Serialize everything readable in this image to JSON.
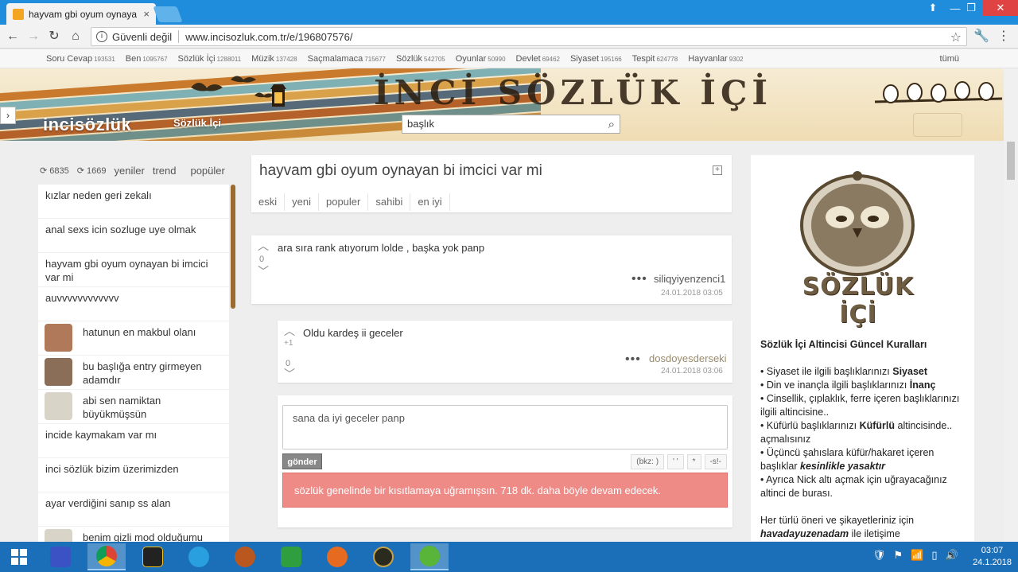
{
  "browser": {
    "tab_title": "hayvam gbi oyum oynaya",
    "tab_close": "×",
    "security_label": "Güvenli değil",
    "url": "www.incisozluk.com.tr/e/196807576/",
    "icons": [
      "back-icon",
      "forward-icon",
      "reload-icon",
      "home-icon",
      "info-icon",
      "star-icon",
      "extension-icon",
      "menu-icon"
    ]
  },
  "categories": [
    {
      "name": "Soru Cevap",
      "count": "193531"
    },
    {
      "name": "Ben",
      "count": "1095767"
    },
    {
      "name": "Sözlük İçi",
      "count": "1288011"
    },
    {
      "name": "Müzik",
      "count": "137428"
    },
    {
      "name": "Saçmalamaca",
      "count": "715677"
    },
    {
      "name": "Sözlük",
      "count": "542705"
    },
    {
      "name": "Oyunlar",
      "count": "50990"
    },
    {
      "name": "Devlet",
      "count": "69462"
    },
    {
      "name": "Siyaset",
      "count": "195166"
    },
    {
      "name": "Tespit",
      "count": "624778"
    },
    {
      "name": "Hayvanlar",
      "count": "9302"
    }
  ],
  "categories_all": "tümü",
  "banner": {
    "logo": "incisözlük",
    "section_label": "Sözlük İçi",
    "title": "İNCİ SÖZLÜK İÇİ",
    "search_placeholder": "başlık"
  },
  "left": {
    "count_a": "6835",
    "count_b": "1669",
    "tabs": [
      "yeniler",
      "trend",
      "popüler"
    ],
    "items": [
      {
        "text": "kızlar neden geri zekalı",
        "avatar": false
      },
      {
        "text": "anal sexs icin sozluge uye olmak",
        "avatar": false
      },
      {
        "text": "hayvam gbi oyum oynayan bi imcici var mi",
        "avatar": false
      },
      {
        "text": "auvvvvvvvvvvvv",
        "avatar": false
      },
      {
        "text": "hatunun en makbul olanı",
        "avatar": true
      },
      {
        "text": "bu başlığa entry girmeyen adamdır",
        "avatar": true
      },
      {
        "text": "abi sen namiktan büyükmüşsün",
        "avatar": true
      },
      {
        "text": "incide kaymakam var mı",
        "avatar": false
      },
      {
        "text": "inci sözlük bizim üzerimizden",
        "avatar": false
      },
      {
        "text": "ayar verdiğini sanıp ss alan",
        "avatar": false
      },
      {
        "text": "benim gizli mod olduğumu",
        "avatar": true
      }
    ]
  },
  "topic": {
    "title": "hayvam gbi oyum oynayan bi imcici var mi",
    "expand": "+",
    "tabs": [
      "eski",
      "yeni",
      "populer",
      "sahibi",
      "en iyi"
    ]
  },
  "entries": [
    {
      "text": "ara sıra rank atıyorum lolde , başka yok panp",
      "score": "0",
      "plus": "",
      "author": "siliqyiyenzenci1",
      "date": "24.01.2018 03:05",
      "author_color": "#555555"
    },
    {
      "text": "Oldu kardeş ii geceler",
      "score": "0",
      "plus": "+1",
      "author": "dosdoyesderseki",
      "date": "24.01.2018 03:06",
      "author_color": "#9a8a6a"
    }
  ],
  "reply": {
    "text": "sana da iyi geceler panp",
    "send_label": "gönder",
    "format_buttons": [
      "(bkz: )",
      "' '",
      "*",
      "-s!-"
    ],
    "alert": "sözlük genelinde bir kısıtlamaya uğramışsın. 718 dk. daha böyle devam edecek."
  },
  "right": {
    "logo_text": "SÖZLÜK İÇİ",
    "rules_title": "Sözlük İçi Altincisi Güncel Kuralları",
    "rules": [
      {
        "pre": "• Siyaset ile ilgili başlıklarınızı ",
        "bold": "Siyaset",
        "post": ""
      },
      {
        "pre": "• Din ve inançla ilgili başlıklarınızı ",
        "bold": "İnanç",
        "post": ""
      },
      {
        "pre": "• Cinsellik, çıplaklık, ferre içeren başlıklarınızı ilgili altincisine..",
        "bold": "",
        "post": ""
      },
      {
        "pre": "• Küfürlü başlıklarınızı ",
        "bold": "Küfürlü",
        "post": " altincisinde.. açmalısınız"
      },
      {
        "pre": "• Üçüncü şahıslara küfür/hakaret içeren başlıklar ",
        "bold": "kesinlikle yasaktır",
        "post": ""
      },
      {
        "pre": "• Ayrıca Nick altı açmak için uğrayacağınız altinci de burası.",
        "bold": "",
        "post": ""
      }
    ],
    "footer_pre": "Her türlü öneri ve şikayetleriniz için",
    "footer_bold": "havadayuzenadam",
    "footer_post": " ile iletişime"
  },
  "taskbar": {
    "time": "03:07",
    "date": "24.1.2018"
  },
  "colors": {
    "titlebar": "#1f8ddb",
    "alert": "#ef8b87",
    "taskbar": "#1a6fb8",
    "scroll_accent": "#9a6a2e"
  }
}
